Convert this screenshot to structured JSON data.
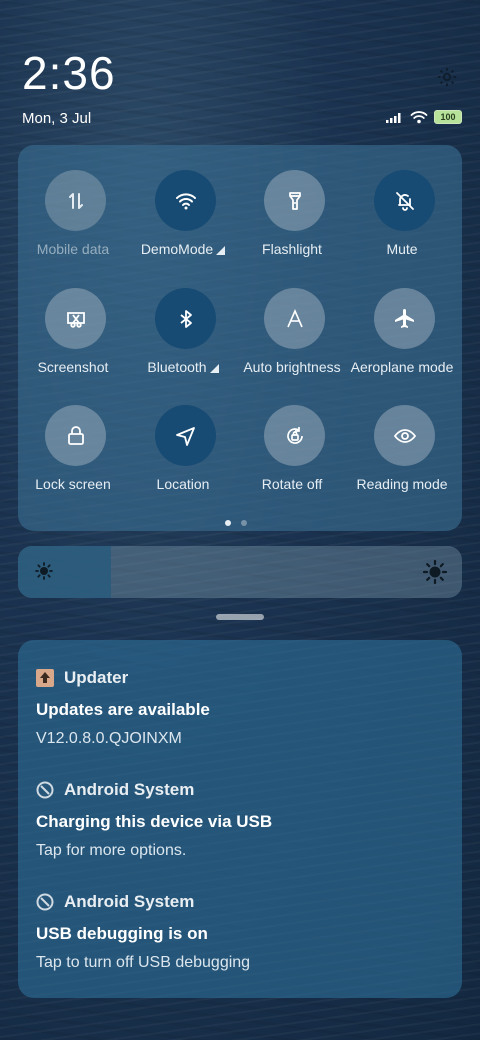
{
  "status": {
    "time": "2:36",
    "date": "Mon, 3 Jul",
    "battery": "100"
  },
  "tiles": [
    {
      "label": "Mobile data",
      "icon": "mobile-data-icon",
      "state": "disabled",
      "arrow": false
    },
    {
      "label": "DemoMode",
      "icon": "wifi-icon",
      "state": "on",
      "arrow": true
    },
    {
      "label": "Flashlight",
      "icon": "flashlight-icon",
      "state": "off",
      "arrow": false
    },
    {
      "label": "Mute",
      "icon": "mute-bell-icon",
      "state": "on",
      "arrow": false
    },
    {
      "label": "Screenshot",
      "icon": "screenshot-scissors-icon",
      "state": "off",
      "arrow": false
    },
    {
      "label": "Bluetooth",
      "icon": "bluetooth-icon",
      "state": "on",
      "arrow": true
    },
    {
      "label": "Auto brightness",
      "icon": "auto-brightness-icon",
      "state": "off",
      "arrow": false
    },
    {
      "label": "Aeroplane mode",
      "icon": "aeroplane-icon",
      "state": "off",
      "arrow": false
    },
    {
      "label": "Lock screen",
      "icon": "lock-icon",
      "state": "off",
      "arrow": false
    },
    {
      "label": "Location",
      "icon": "location-icon",
      "state": "on",
      "arrow": false
    },
    {
      "label": "Rotate off",
      "icon": "rotate-lock-icon",
      "state": "off",
      "arrow": false
    },
    {
      "label": "Reading mode",
      "icon": "eye-icon",
      "state": "off",
      "arrow": false
    }
  ],
  "pager": {
    "pages": 2,
    "current": 1
  },
  "brightness": {
    "level": 0.21
  },
  "notifications": [
    {
      "app": "Updater",
      "title": "Updates are available",
      "body": "V12.0.8.0.QJOINXM"
    },
    {
      "app": "Android System",
      "title": "Charging this device via USB",
      "body": "Tap for more options."
    },
    {
      "app": "Android System",
      "title": "USB debugging is on",
      "body": "Tap to turn off USB debugging"
    }
  ]
}
